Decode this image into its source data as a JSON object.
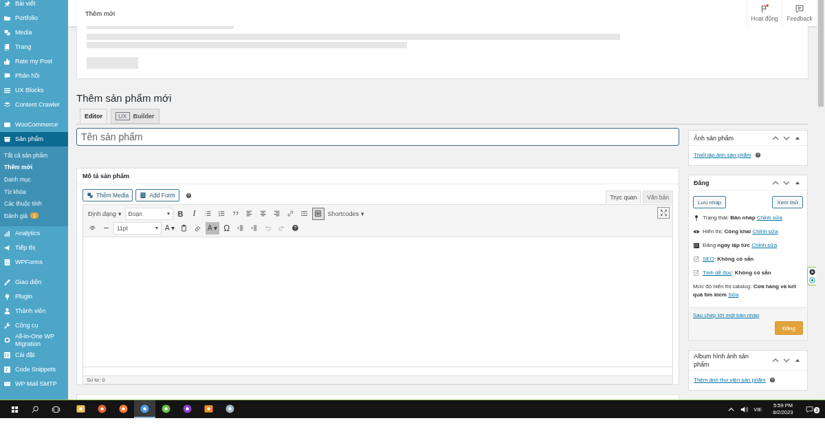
{
  "sidebar": {
    "groups": [
      [
        {
          "label": "Bài viết",
          "selected": false
        },
        {
          "label": "Portfolio",
          "selected": false
        },
        {
          "label": "Media",
          "selected": false
        },
        {
          "label": "Trang",
          "selected": false
        },
        {
          "label": "Rate my Post",
          "selected": false
        },
        {
          "label": "Phản hồi",
          "selected": false
        },
        {
          "label": "UX Blocks",
          "selected": false
        },
        {
          "label": "Content Crawler",
          "selected": false
        }
      ],
      [
        {
          "label": "WooCommerce",
          "selected": false
        },
        {
          "label": "Sản phẩm",
          "selected": true,
          "children": [
            {
              "label": "Tất cả sản phẩm",
              "selected": false
            },
            {
              "label": "Thêm mới",
              "selected": true
            },
            {
              "label": "Danh mục",
              "selected": false
            },
            {
              "label": "Từ khóa",
              "selected": false
            },
            {
              "label": "Các thuộc tính",
              "selected": false
            },
            {
              "label": "Đánh giá",
              "selected": false,
              "badge": "1"
            }
          ]
        },
        {
          "label": "Analytics",
          "selected": false
        },
        {
          "label": "Tiếp thị",
          "selected": false
        },
        {
          "label": "WPForms",
          "selected": false
        }
      ],
      [
        {
          "label": "Giao diện",
          "selected": false
        },
        {
          "label": "Plugin",
          "selected": false
        },
        {
          "label": "Thành viên",
          "selected": false
        },
        {
          "label": "Công cụ",
          "selected": false
        },
        {
          "label": "All-in-One WP Migration",
          "selected": false
        },
        {
          "label": "Cài đặt",
          "selected": false
        },
        {
          "label": "Code Snippets",
          "selected": false
        },
        {
          "label": "WP Mail SMTP",
          "selected": false
        }
      ]
    ]
  },
  "header": {
    "title": "Thêm mới",
    "actions": [
      {
        "label": "Hoạt động",
        "notification": true
      },
      {
        "label": "Feedback",
        "notification": false
      }
    ]
  },
  "page_title": "Thêm sản phẩm mới",
  "editor_tabs": [
    {
      "label": "Editor",
      "selected": true
    },
    {
      "label": "Builder",
      "selected": false,
      "logo": "UX"
    }
  ],
  "title_field": {
    "placeholder": "Tên sản phẩm"
  },
  "description": {
    "title": "Mô tả sản phẩm",
    "media_buttons": [
      "Thêm Media",
      "Add Form"
    ],
    "mode_tabs": [
      {
        "label": "Trực quan",
        "selected": true
      },
      {
        "label": "Văn bản",
        "selected": false
      }
    ],
    "toolbar_rows": [
      [
        {
          "kind": "menu",
          "label": "Định dạng ▾"
        },
        {
          "kind": "select",
          "label": "Đoạn",
          "caret": "▾"
        },
        {
          "kind": "bold",
          "label": "B"
        },
        {
          "kind": "italic",
          "label": "I"
        },
        {
          "kind": "bullets"
        },
        {
          "kind": "numbers"
        },
        {
          "kind": "quote"
        },
        {
          "kind": "alignleft"
        },
        {
          "kind": "aligncenter"
        },
        {
          "kind": "alignright"
        },
        {
          "kind": "link"
        },
        {
          "kind": "more"
        },
        {
          "kind": "toggle"
        },
        {
          "kind": "menu",
          "label": "Shortcodes ▾"
        }
      ],
      [
        {
          "kind": "strike"
        },
        {
          "kind": "hr"
        },
        {
          "kind": "select",
          "label": "11pt",
          "caret": "▾"
        },
        {
          "kind": "color",
          "label": "A ▾"
        },
        {
          "kind": "paste"
        },
        {
          "kind": "eraser"
        },
        {
          "kind": "highlight",
          "label": "A ▾"
        },
        {
          "kind": "glyph",
          "label": "Ω"
        },
        {
          "kind": "outdent"
        },
        {
          "kind": "indent"
        },
        {
          "kind": "undo"
        },
        {
          "kind": "redo"
        },
        {
          "kind": "help"
        }
      ]
    ],
    "word_count": "Số từ: 0"
  },
  "product_image": {
    "title": "Ảnh sản phẩm",
    "link": "Thiết lập ảnh sản phẩm"
  },
  "publish": {
    "title": "Đăng",
    "buttons": [
      "Lưu nháp",
      "Xem thử"
    ],
    "rows": [
      {
        "text": "Trạng thái: **Bản nháp**",
        "link": "Chỉnh sửa"
      },
      {
        "text": "Hiển thị: **Công khai**",
        "link": "Chỉnh sửa"
      },
      {
        "text": "Đăng **ngay lập tức**",
        "link": "Chỉnh sửa"
      },
      {
        "lead_link": "SEO",
        "text": ": **Không có sẵn**"
      },
      {
        "lead_link": "Tính dễ đọc",
        "text": ": **Không có sẵn**"
      },
      {
        "text": "Mức độ hiển thị catalog: **Cửa hàng và kết quả tìm kiếm**",
        "link": "Sửa"
      }
    ],
    "copy_link": "Sao chép tới một bản nháp",
    "submit": "Đăng"
  },
  "gallery": {
    "title": "Album hình ảnh sản phẩm",
    "link": "Thêm ảnh thư viện sản phẩm"
  },
  "taskbar": {
    "apps": [
      {
        "selected": false
      },
      {
        "selected": false
      },
      {
        "selected": false
      },
      {
        "selected": true
      },
      {
        "selected": false
      },
      {
        "selected": false
      },
      {
        "selected": false
      },
      {
        "selected": false
      }
    ],
    "language": "VIE",
    "time": "5:59 PM",
    "date": "8/2/2023",
    "notifications": "3"
  }
}
